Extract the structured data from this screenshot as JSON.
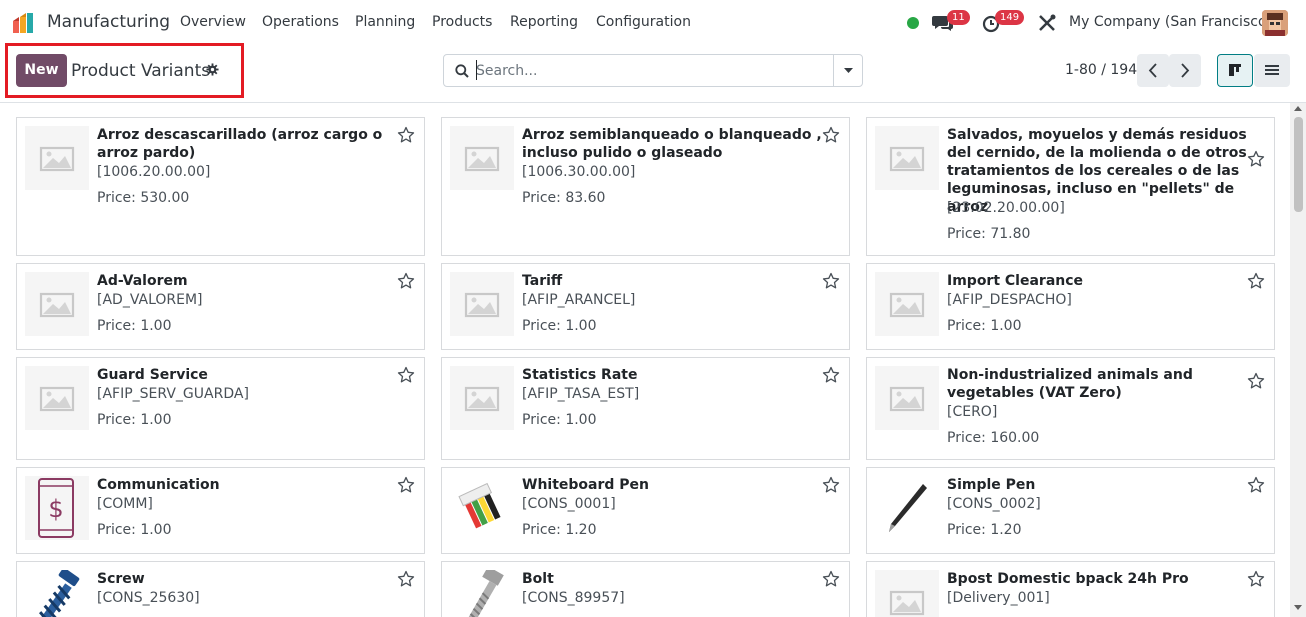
{
  "navbar": {
    "app_name": "Manufacturing",
    "menu": [
      "Overview",
      "Operations",
      "Planning",
      "Products",
      "Reporting",
      "Configuration"
    ],
    "messages_count": "11",
    "activities_count": "149",
    "company": "My Company (San Francisco)",
    "status_color": "#28a745"
  },
  "control": {
    "new_label": "New",
    "title": "Product Variants",
    "search_placeholder": "Search...",
    "pager": "1-80 / 194"
  },
  "colors": {
    "brand": "#714b67",
    "accent": "#017e84",
    "highlight": "#e31b23"
  },
  "cards": [
    {
      "name": "Arroz descascarillado (arroz cargo o arroz pardo)",
      "code": "[1006.20.00.00]",
      "price": "Price: 530.00",
      "image": "placeholder-image-icon"
    },
    {
      "name": "Arroz semiblanqueado o blanqueado , incluso pulido o glaseado",
      "code": "[1006.30.00.00]",
      "price": "Price: 83.60",
      "image": "placeholder-image-icon"
    },
    {
      "name": "Salvados, moyuelos y demás residuos del cernido, de la molienda o de otros tratamientos de los cereales o de las leguminosas, incluso en \"pellets\" de arroz",
      "code": "[23.02.20.00.00]",
      "price": "Price: 71.80",
      "image": "placeholder-image-icon"
    },
    {
      "name": "Ad-Valorem",
      "code": "[AD_VALOREM]",
      "price": "Price: 1.00",
      "image": "placeholder-image-icon"
    },
    {
      "name": "Tariff",
      "code": "[AFIP_ARANCEL]",
      "price": "Price: 1.00",
      "image": "placeholder-image-icon"
    },
    {
      "name": "Import Clearance",
      "code": "[AFIP_DESPACHO]",
      "price": "Price: 1.00",
      "image": "placeholder-image-icon"
    },
    {
      "name": "Guard Service",
      "code": "[AFIP_SERV_GUARDA]",
      "price": "Price: 1.00",
      "image": "placeholder-image-icon"
    },
    {
      "name": "Statistics Rate",
      "code": "[AFIP_TASA_EST]",
      "price": "Price: 1.00",
      "image": "placeholder-image-icon"
    },
    {
      "name": "Non-industrialized animals and vegetables (VAT Zero)",
      "code": "[CERO]",
      "price": "Price: 160.00",
      "image": "placeholder-image-icon"
    },
    {
      "name": "Communication",
      "code": "[COMM]",
      "price": "Price: 1.00",
      "image": "phone-dollar-icon"
    },
    {
      "name": "Whiteboard Pen",
      "code": "[CONS_0001]",
      "price": "Price: 1.20",
      "image": "markers-image"
    },
    {
      "name": "Simple Pen",
      "code": "[CONS_0002]",
      "price": "Price: 1.20",
      "image": "pen-image"
    },
    {
      "name": "Screw",
      "code": "[CONS_25630]",
      "price": "",
      "image": "screw-image"
    },
    {
      "name": "Bolt",
      "code": "[CONS_89957]",
      "price": "",
      "image": "bolt-image"
    },
    {
      "name": "Bpost Domestic bpack 24h Pro",
      "code": "[Delivery_001]",
      "price": "",
      "image": "placeholder-image-icon"
    }
  ]
}
